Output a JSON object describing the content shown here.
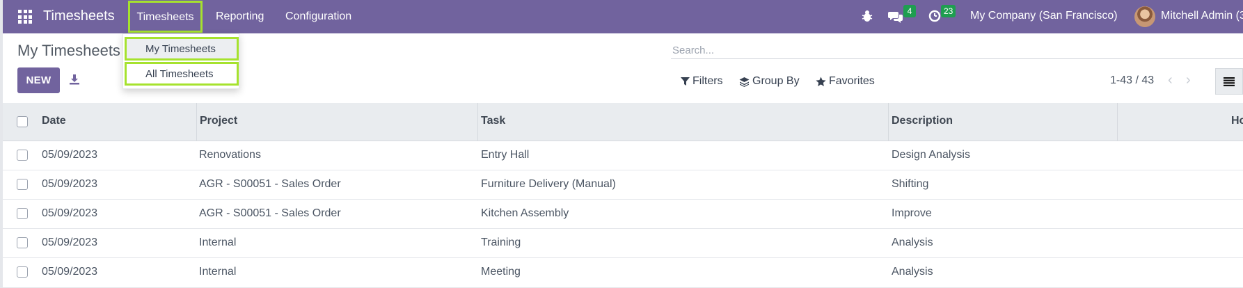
{
  "navbar": {
    "brand": "Timesheets",
    "menu": [
      "Timesheets",
      "Reporting",
      "Configuration"
    ],
    "chat_badge": "4",
    "activity_badge": "23",
    "company": "My Company (San Francisco)",
    "user": "Mitchell Admin (3",
    "bg_color": "#71639e",
    "highlight_color": "#a6e22e"
  },
  "dropdown": {
    "items": [
      "My Timesheets",
      "All Timesheets"
    ]
  },
  "control_panel": {
    "title": "My Timesheets",
    "new_label": "NEW",
    "search_placeholder": "Search...",
    "filters_label": "Filters",
    "group_by_label": "Group By",
    "favorites_label": "Favorites",
    "pager": "1-43 / 43"
  },
  "table": {
    "columns": [
      "Date",
      "Project",
      "Task",
      "Description",
      "Ho"
    ],
    "rows": [
      {
        "date": "05/09/2023",
        "project": "Renovations",
        "task": "Entry Hall",
        "description": "Design Analysis"
      },
      {
        "date": "05/09/2023",
        "project": "AGR - S00051 - Sales Order",
        "task": "Furniture Delivery (Manual)",
        "description": "Shifting"
      },
      {
        "date": "05/09/2023",
        "project": "AGR - S00051 - Sales Order",
        "task": "Kitchen Assembly",
        "description": "Improve"
      },
      {
        "date": "05/09/2023",
        "project": "Internal",
        "task": "Training",
        "description": "Analysis"
      },
      {
        "date": "05/09/2023",
        "project": "Internal",
        "task": "Meeting",
        "description": "Analysis"
      }
    ]
  }
}
